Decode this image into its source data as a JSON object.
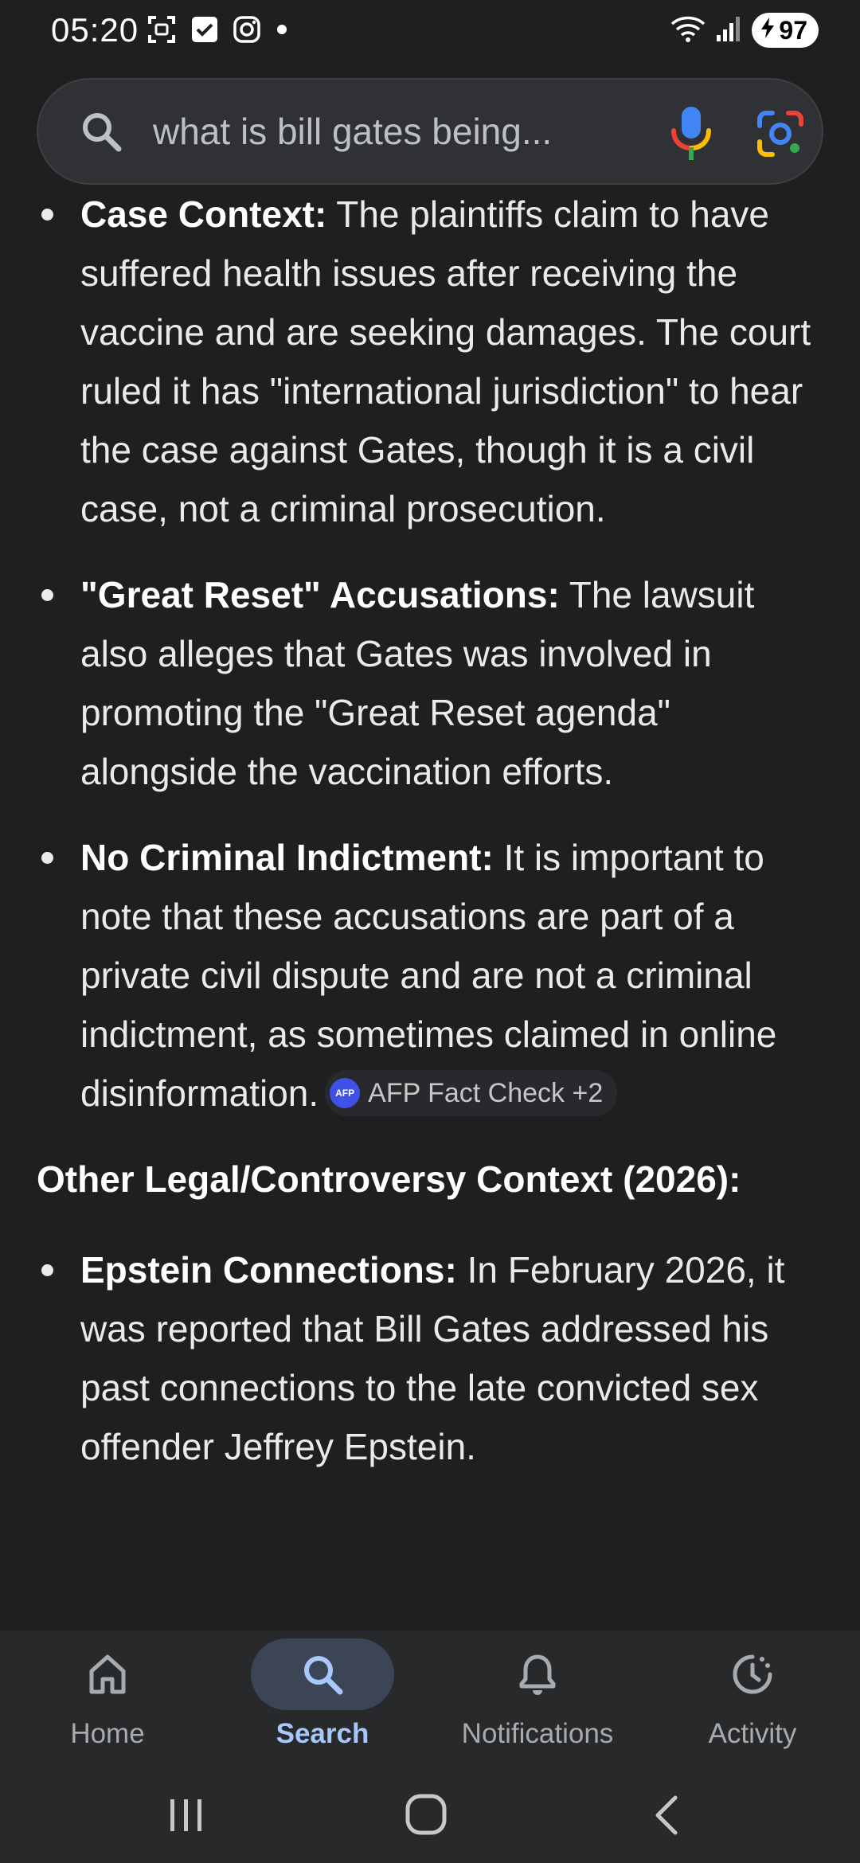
{
  "status_bar": {
    "time": "05:20",
    "battery": "97",
    "left_icons": [
      "screenshot-icon",
      "checkbox-icon",
      "instagram-icon",
      "notification-dot-icon"
    ],
    "right_icons": [
      "wifi-icon",
      "signal-icon",
      "battery-charging-icon"
    ]
  },
  "search": {
    "query": "what is bill gates being..."
  },
  "bullets_top": [
    {
      "label": "Case Context:",
      "text": " The plaintiffs claim to have suffered health issues after receiving the vaccine and are seeking damages. The court ruled it has \"international jurisdiction\" to hear the case against Gates, though it is a civil case, not a criminal prosecution."
    },
    {
      "label": "\"Great Reset\" Accusations:",
      "text": " The lawsuit also alleges that Gates was involved in promoting the \"Great Reset agenda\" alongside the vaccination efforts."
    },
    {
      "label": "No Criminal Indictment:",
      "text": " It is important to note that these accusations are part of a private civil dispute and are not a criminal indictment, as sometimes claimed in online disinformation.",
      "source_chip": {
        "logo": "AFP",
        "text": "AFP Fact Check +2"
      }
    }
  ],
  "section_heading": "Other Legal/Controversy Context (2026):",
  "bullets_bottom": [
    {
      "label": "Epstein Connections:",
      "text": " In February 2026, it was reported that Bill Gates addressed his past connections to the late convicted sex offender Jeffrey Epstein."
    }
  ],
  "bottom_nav": {
    "items": [
      {
        "label": "Home",
        "icon": "home-icon",
        "active": false
      },
      {
        "label": "Search",
        "icon": "search-icon",
        "active": true
      },
      {
        "label": "Notifications",
        "icon": "bell-icon",
        "active": false
      },
      {
        "label": "Activity",
        "icon": "activity-icon",
        "active": false
      }
    ]
  },
  "colors": {
    "background": "#1f1f1f",
    "search_bar": "#303134",
    "active_nav": "#a8c7fa",
    "active_pill": "#3b4556"
  }
}
